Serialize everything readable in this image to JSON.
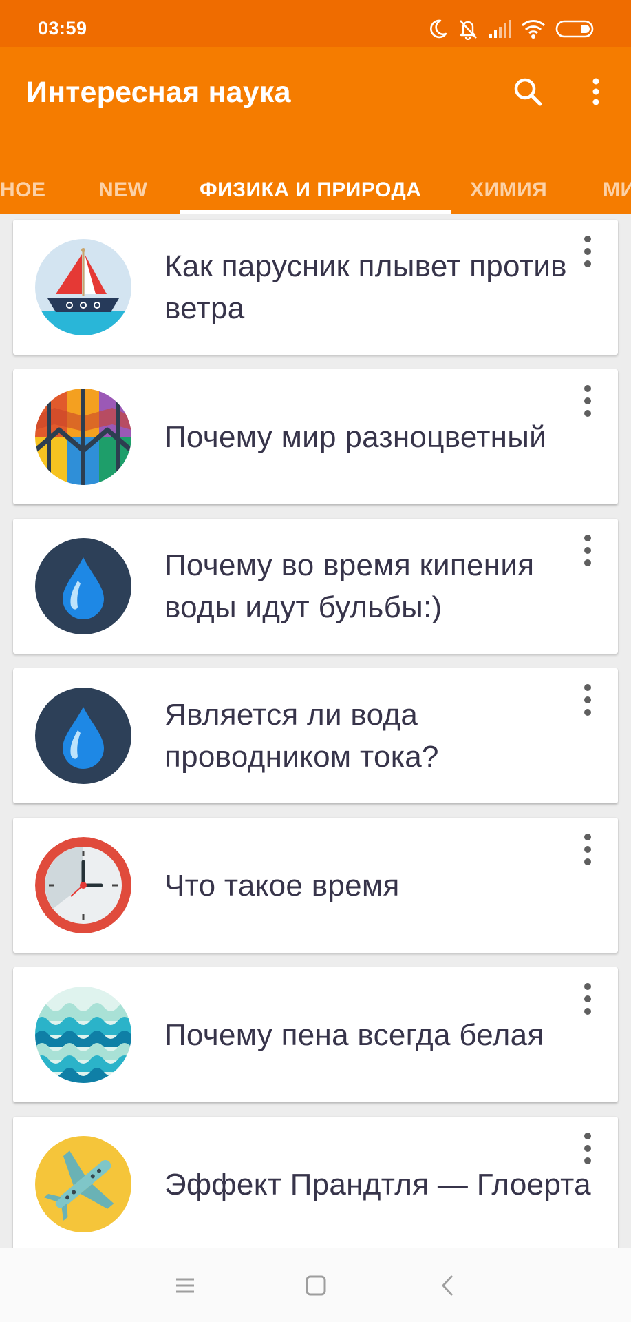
{
  "status_bar": {
    "time": "03:59",
    "icons": [
      "moon-icon",
      "bell-off-icon",
      "signal-icon",
      "wifi-icon",
      "battery-icon"
    ]
  },
  "app_bar": {
    "title": "Интересная наука",
    "search_icon": "search-icon",
    "more_icon": "more-vert-icon",
    "background": "#f57c00"
  },
  "tabs": [
    {
      "label": "НОЕ",
      "active": false
    },
    {
      "label": "NEW",
      "active": false
    },
    {
      "label": "ФИЗИКА И ПРИРОДА",
      "active": true
    },
    {
      "label": "ХИМИЯ",
      "active": false
    },
    {
      "label": "МИ",
      "active": false
    }
  ],
  "articles": [
    {
      "title": "Как парусник плывет против ветра",
      "icon": "sailboat-icon"
    },
    {
      "title": "Почему мир разноцветный",
      "icon": "colorful-ball-icon"
    },
    {
      "title": "Почему во время кипения воды идут бульбы:)",
      "icon": "water-drop-icon"
    },
    {
      "title": "Является ли вода проводником тока?",
      "icon": "water-drop-icon"
    },
    {
      "title": "Что такое время",
      "icon": "clock-icon"
    },
    {
      "title": "Почему пена всегда белая",
      "icon": "waves-icon"
    },
    {
      "title": "Эффект Прандтля — Глоерта",
      "icon": "airplane-icon"
    }
  ],
  "nav_bar": {
    "icons": [
      "menu-icon",
      "home-icon",
      "back-icon"
    ]
  }
}
